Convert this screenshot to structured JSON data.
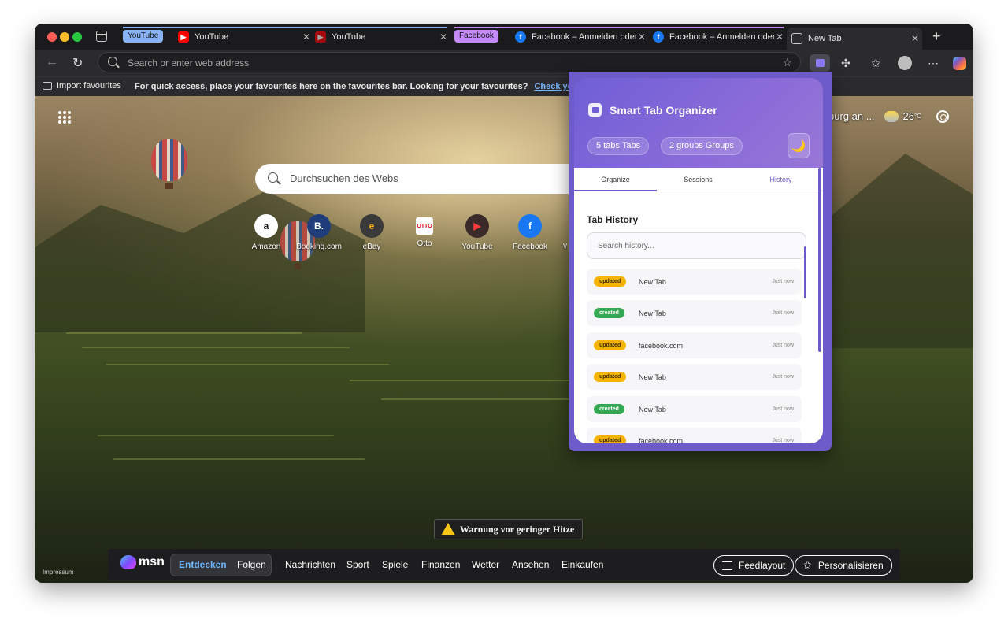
{
  "tabstrip": {
    "groups": [
      {
        "label": "YouTube",
        "color": "#8ab4f8"
      },
      {
        "label": "Facebook",
        "color": "#c58af9"
      }
    ],
    "tabs": [
      {
        "title": "YouTube",
        "icon": "youtube-icon"
      },
      {
        "title": "YouTube",
        "icon": "youtube-icon"
      },
      {
        "title": "Facebook – Anmelden oder",
        "icon": "facebook-icon"
      },
      {
        "title": "Facebook – Anmelden oder",
        "icon": "facebook-icon"
      },
      {
        "title": "New Tab",
        "icon": "new-tab-icon",
        "active": true
      }
    ]
  },
  "toolbar": {
    "address_placeholder": "Search or enter web address"
  },
  "favbar": {
    "import_label": "Import favourites",
    "message": "For quick access, place your favourites here on the favourites bar. Looking for your favourites?",
    "link": "Check your profiles"
  },
  "newtab": {
    "search_placeholder": "Durchsuchen des Webs",
    "tiles": [
      {
        "label": "Amazon",
        "glyph": "a"
      },
      {
        "label": "Booking.com",
        "glyph": "B."
      },
      {
        "label": "eBay",
        "glyph": "e"
      },
      {
        "label": "Otto",
        "glyph": "OTTO"
      },
      {
        "label": "YouTube",
        "glyph": "▶"
      },
      {
        "label": "Facebook",
        "glyph": "f"
      },
      {
        "label": "W",
        "glyph": "W"
      }
    ],
    "weather_location": "burg an ...",
    "weather_temp": "26",
    "weather_unit": "°C",
    "warning": "Warnung vor geringer Hitze",
    "impressum": "Impressum"
  },
  "msn": {
    "logo": "msn",
    "links": [
      "Entdecken",
      "Folgen",
      "Nachrichten",
      "Sport",
      "Spiele",
      "Finanzen",
      "Wetter",
      "Ansehen",
      "Einkaufen"
    ],
    "feed_button": "Feedlayout",
    "personalize_button": "Personalisieren"
  },
  "popup": {
    "title": "Smart Tab Organizer",
    "tabs_count": "5 tabs",
    "tabs_label": "Tabs",
    "groups_count": "2 groups",
    "groups_label": "Groups",
    "theme_icon": "🌙",
    "nav": [
      "Organize",
      "Sessions",
      "History"
    ],
    "history_title": "Tab History",
    "search_placeholder": "Search history...",
    "history": [
      {
        "action": "updated",
        "title": "New Tab",
        "time": "Just now"
      },
      {
        "action": "created",
        "title": "New Tab",
        "time": "Just now"
      },
      {
        "action": "updated",
        "title": "facebook.com",
        "time": "Just now"
      },
      {
        "action": "updated",
        "title": "New Tab",
        "time": "Just now"
      },
      {
        "action": "created",
        "title": "New Tab",
        "time": "Just now"
      },
      {
        "action": "updated",
        "title": "facebook.com",
        "time": "Just now"
      }
    ]
  },
  "colors": {
    "accent": "#6c5bc9",
    "updated": "#f4b400",
    "created": "#34a853"
  }
}
